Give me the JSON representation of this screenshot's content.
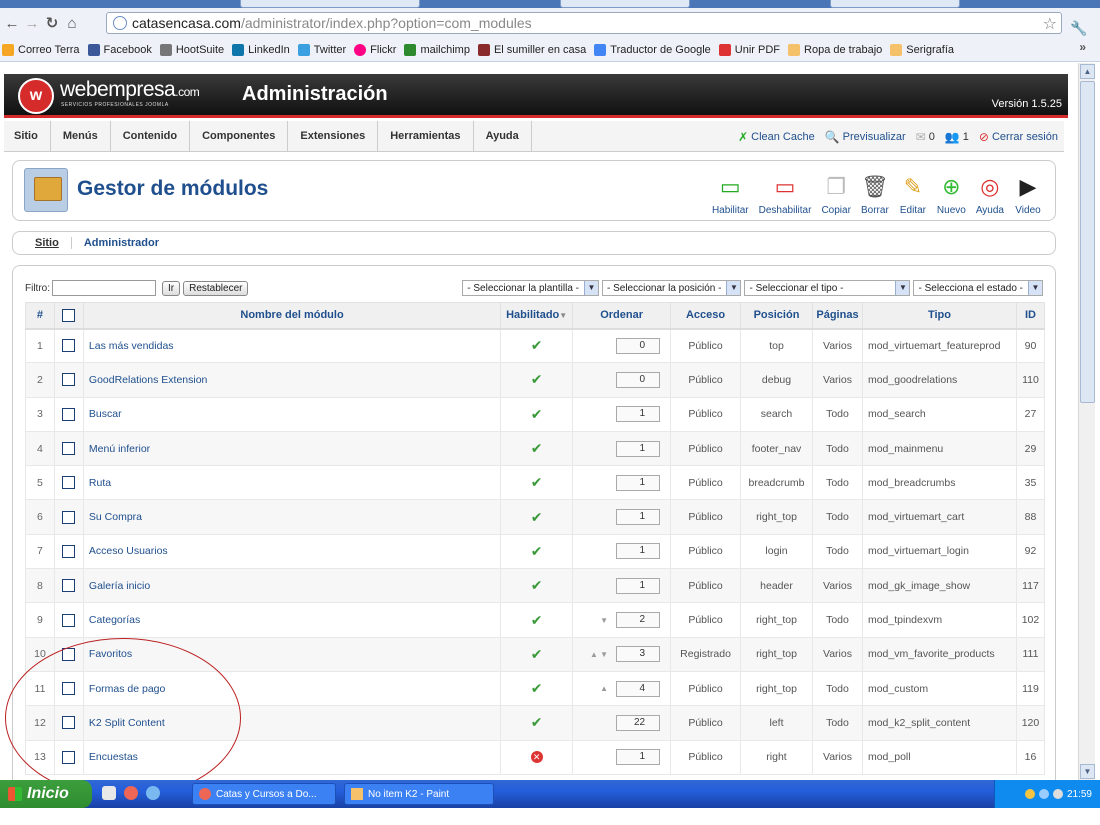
{
  "browser": {
    "url_host": "catasencasa.com",
    "url_path": "/administrator/index.php?option=com_modules",
    "bookmarks": [
      "Correo Terra",
      "Facebook",
      "HootSuite",
      "LinkedIn",
      "Twitter",
      "Flickr",
      "mailchimp",
      "El sumiller en casa",
      "Traductor de Google",
      "Unir PDF",
      "Ropa de trabajo",
      "Serigrafía"
    ]
  },
  "header": {
    "brand": "webempresa",
    "brand_suffix": ".com",
    "brand_tagline": "SERVICIOS PROFESIONALES JOOMLA",
    "title": "Administración",
    "version": "Versión 1.5.25"
  },
  "menu": {
    "items": [
      "Sitio",
      "Menús",
      "Contenido",
      "Componentes",
      "Extensiones",
      "Herramientas",
      "Ayuda"
    ],
    "clean_cache": "Clean Cache",
    "preview": "Previsualizar",
    "messages_count": "0",
    "users_count": "1",
    "logout": "Cerrar sesión"
  },
  "toolbar": {
    "title": "Gestor de módulos",
    "buttons": [
      "Habilitar",
      "Deshabilitar",
      "Copiar",
      "Borrar",
      "Editar",
      "Nuevo",
      "Ayuda",
      "Video"
    ]
  },
  "subnav": {
    "site": "Sitio",
    "admin": "Administrador"
  },
  "filter": {
    "label": "Filtro:",
    "value": "",
    "go": "Ir",
    "reset": "Restablecer",
    "template_select": "- Seleccionar la plantilla -",
    "position_select": "- Seleccionar la posición -",
    "type_select": "- Seleccionar el tipo -",
    "state_select": "- Selecciona el estado -"
  },
  "table": {
    "headers": [
      "#",
      "",
      "Nombre del módulo",
      "Habilitado",
      "Ordenar",
      "Acceso",
      "Posición",
      "Páginas",
      "Tipo",
      "ID"
    ],
    "rows": [
      {
        "n": "1",
        "name": "Las más vendidas",
        "enabled": true,
        "order": "0",
        "arrows": "",
        "access": "Público",
        "position": "top",
        "pages": "Varios",
        "type": "mod_virtuemart_featureprod",
        "id": "90"
      },
      {
        "n": "2",
        "name": "GoodRelations Extension",
        "enabled": true,
        "order": "0",
        "arrows": "",
        "access": "Público",
        "position": "debug",
        "pages": "Varios",
        "type": "mod_goodrelations",
        "id": "110"
      },
      {
        "n": "3",
        "name": "Buscar",
        "enabled": true,
        "order": "1",
        "arrows": "",
        "access": "Público",
        "position": "search",
        "pages": "Todo",
        "type": "mod_search",
        "id": "27"
      },
      {
        "n": "4",
        "name": "Menú inferior",
        "enabled": true,
        "order": "1",
        "arrows": "",
        "access": "Público",
        "position": "footer_nav",
        "pages": "Todo",
        "type": "mod_mainmenu",
        "id": "29"
      },
      {
        "n": "5",
        "name": "Ruta",
        "enabled": true,
        "order": "1",
        "arrows": "",
        "access": "Público",
        "position": "breadcrumb",
        "pages": "Todo",
        "type": "mod_breadcrumbs",
        "id": "35"
      },
      {
        "n": "6",
        "name": "Su Compra",
        "enabled": true,
        "order": "1",
        "arrows": "",
        "access": "Público",
        "position": "right_top",
        "pages": "Todo",
        "type": "mod_virtuemart_cart",
        "id": "88"
      },
      {
        "n": "7",
        "name": "Acceso Usuarios",
        "enabled": true,
        "order": "1",
        "arrows": "",
        "access": "Público",
        "position": "login",
        "pages": "Todo",
        "type": "mod_virtuemart_login",
        "id": "92"
      },
      {
        "n": "8",
        "name": "Galería inicio",
        "enabled": true,
        "order": "1",
        "arrows": "",
        "access": "Público",
        "position": "header",
        "pages": "Varios",
        "type": "mod_gk_image_show",
        "id": "117"
      },
      {
        "n": "9",
        "name": "Categorías",
        "enabled": true,
        "order": "2",
        "arrows": "▼",
        "access": "Público",
        "position": "right_top",
        "pages": "Todo",
        "type": "mod_tpindexvm",
        "id": "102"
      },
      {
        "n": "10",
        "name": "Favoritos",
        "enabled": true,
        "order": "3",
        "arrows": "▲ ▼",
        "access": "Registrado",
        "position": "right_top",
        "pages": "Varios",
        "type": "mod_vm_favorite_products",
        "id": "111"
      },
      {
        "n": "11",
        "name": "Formas de pago",
        "enabled": true,
        "order": "4",
        "arrows": "▲",
        "access": "Público",
        "position": "right_top",
        "pages": "Todo",
        "type": "mod_custom",
        "id": "119"
      },
      {
        "n": "12",
        "name": "K2 Split Content",
        "enabled": true,
        "order": "22",
        "arrows": "",
        "access": "Público",
        "position": "left",
        "pages": "Todo",
        "type": "mod_k2_split_content",
        "id": "120"
      },
      {
        "n": "13",
        "name": "Encuestas",
        "enabled": false,
        "order": "1",
        "arrows": "",
        "access": "Público",
        "position": "right",
        "pages": "Varios",
        "type": "mod_poll",
        "id": "16"
      }
    ]
  },
  "taskbar": {
    "start": "Inicio",
    "tasks": [
      "Catas y Cursos a Do...",
      "No item K2 - Paint"
    ],
    "clock": "21:59"
  }
}
